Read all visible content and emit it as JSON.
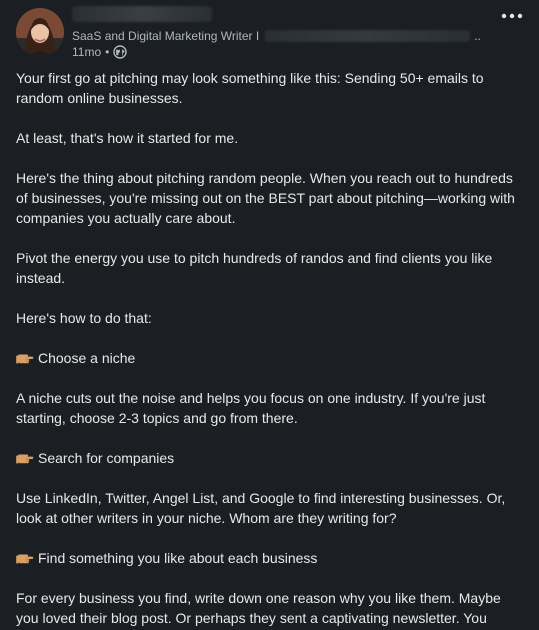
{
  "post": {
    "author": {
      "headline": "SaaS and Digital Marketing Writer I",
      "headline_ellipsis": "..",
      "time": "11mo",
      "dot": "•",
      "visibility_icon": "globe-icon"
    },
    "more_menu_icon": "ellipsis-icon",
    "content": {
      "p1": "Your first go at pitching may look something like this: Sending 50+ emails to random online businesses.",
      "p2": "At least, that's how it started for me.",
      "p3": "Here's the thing about pitching random people. When you reach out to hundreds of businesses, you're missing out on the BEST part about pitching—working with companies you actually care about.",
      "p4": "Pivot the energy you use to pitch hundreds of randos and find clients you like instead.",
      "p5": "Here's how to do that:",
      "b1": "Choose a niche",
      "p6": "A niche cuts out the noise and helps you focus on one industry. If you're just starting, choose 2-3 topics and go from there.",
      "b2": "Search for companies",
      "p7": "Use LinkedIn, Twitter, Angel List, and Google to find interesting businesses. Or, look at other writers in your niche. Whom are they writing for?",
      "b3": "Find something you like about each business",
      "p8": "For every business you find, write down one reason why you like them. Maybe you loved their blog post. Or perhaps they sent a captivating newsletter. You"
    }
  }
}
